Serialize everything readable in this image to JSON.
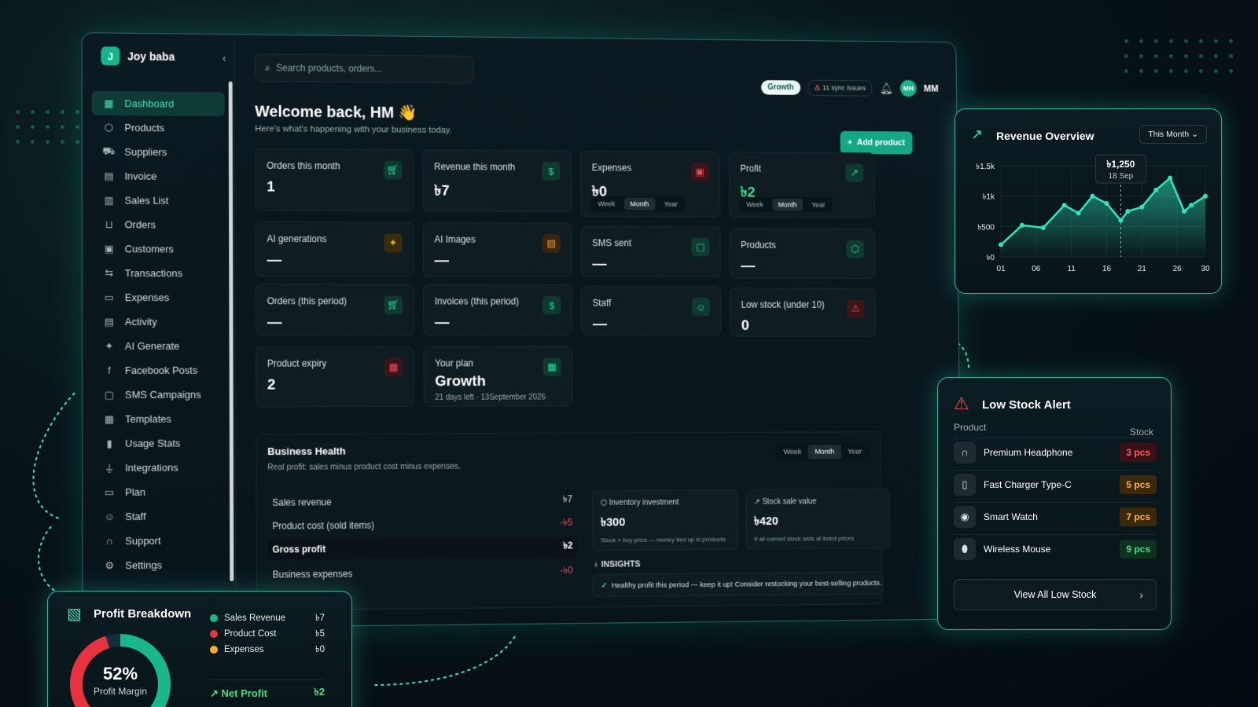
{
  "app": {
    "brand_initial": "J",
    "brand_name": "Joy baba"
  },
  "sidebar": {
    "items": [
      {
        "label": "Dashboard",
        "icon": "grid-icon",
        "glyph": "▦",
        "active": true
      },
      {
        "label": "Products",
        "icon": "cube-icon",
        "glyph": "⬡"
      },
      {
        "label": "Suppliers",
        "icon": "truck-icon",
        "glyph": "⛟"
      },
      {
        "label": "Invoice",
        "icon": "invoice-icon",
        "glyph": "▤"
      },
      {
        "label": "Sales List",
        "icon": "list-icon",
        "glyph": "▥"
      },
      {
        "label": "Orders",
        "icon": "cart-icon",
        "glyph": "⊔"
      },
      {
        "label": "Customers",
        "icon": "clipboard-icon",
        "glyph": "▣"
      },
      {
        "label": "Transactions",
        "icon": "arrows-icon",
        "glyph": "⇆"
      },
      {
        "label": "Expenses",
        "icon": "wallet-icon",
        "glyph": "▭"
      },
      {
        "label": "Activity",
        "icon": "activity-icon",
        "glyph": "▤"
      },
      {
        "label": "AI Generate",
        "icon": "sparkle-icon",
        "glyph": "✦"
      },
      {
        "label": "Facebook Posts",
        "icon": "facebook-icon",
        "glyph": "f"
      },
      {
        "label": "SMS Campaigns",
        "icon": "chat-icon",
        "glyph": "▢"
      },
      {
        "label": "Templates",
        "icon": "template-icon",
        "glyph": "▦"
      },
      {
        "label": "Usage Stats",
        "icon": "bar-chart-icon",
        "glyph": "▮"
      },
      {
        "label": "Integrations",
        "icon": "plug-icon",
        "glyph": "⏚"
      },
      {
        "label": "Plan",
        "icon": "card-icon",
        "glyph": "▭"
      },
      {
        "label": "Staff",
        "icon": "users-icon",
        "glyph": "☺"
      },
      {
        "label": "Support",
        "icon": "headset-icon",
        "glyph": "∩"
      },
      {
        "label": "Settings",
        "icon": "gear-icon",
        "glyph": "⚙"
      }
    ]
  },
  "header": {
    "search_placeholder": "Search products, orders...",
    "plan_badge": "Growth",
    "sync_issues": "11 sync issues",
    "avatar_initials": "MH",
    "user_name": "MM"
  },
  "welcome": {
    "title": "Welcome back, HM 👋",
    "subtitle": "Here's what's happening with your business today.",
    "add_product": "Add product"
  },
  "stats": {
    "orders_month": {
      "label": "Orders this month",
      "value": "1"
    },
    "revenue_month": {
      "label": "Revenue this month",
      "value": "৳7"
    },
    "expenses": {
      "label": "Expenses",
      "value": "৳0"
    },
    "profit": {
      "label": "Profit",
      "value": "৳2"
    },
    "ai_generations": {
      "label": "AI generations",
      "value": "—"
    },
    "ai_images": {
      "label": "AI Images",
      "value": "—"
    },
    "sms_sent": {
      "label": "SMS sent",
      "value": "—"
    },
    "products": {
      "label": "Products",
      "value": "—"
    },
    "orders_period": {
      "label": "Orders (this period)",
      "value": "—"
    },
    "invoices_period": {
      "label": "Invoices (this period)",
      "value": "—"
    },
    "staff": {
      "label": "Staff",
      "value": "—"
    },
    "low_stock": {
      "label": "Low stock (under 10)",
      "value": "0"
    },
    "product_expiry": {
      "label": "Product expiry",
      "value": "2"
    },
    "plan": {
      "label": "Your plan",
      "value": "Growth",
      "sub": "21 days left · 13September 2026"
    }
  },
  "period_tabs": [
    "Week",
    "Month",
    "Year"
  ],
  "business_health": {
    "title": "Business Health",
    "subtitle": "Real profit: sales minus product cost minus expenses.",
    "rows": [
      {
        "label": "Sales revenue",
        "value": "৳7"
      },
      {
        "label": "Product cost (sold items)",
        "value": "-৳5"
      },
      {
        "label": "Gross profit",
        "value": "৳2"
      },
      {
        "label": "Business expenses",
        "value": "-৳0"
      }
    ],
    "inventory": {
      "title": "Inventory investment",
      "value": "৳300",
      "desc": "Stock × buy price — money tied up in products"
    },
    "stock_value": {
      "title": "Stock sale value",
      "value": "৳420",
      "desc": "If all current stock sells at listed prices"
    },
    "insights_title": "INSIGHTS",
    "insight": "Healthy profit this period — keep it up! Consider restocking your best-selling products."
  },
  "revenue_overview": {
    "title": "Revenue Overview",
    "range": "This Month",
    "tooltip_value": "৳1,250",
    "tooltip_date": "18 Sep"
  },
  "chart_data": {
    "type": "area",
    "title": "Revenue Overview",
    "x_ticks": [
      "01",
      "06",
      "11",
      "16",
      "21",
      "26",
      "30"
    ],
    "y_ticks": [
      "৳0",
      "৳500",
      "৳1k",
      "৳1.5k"
    ],
    "ylim": [
      0,
      1500
    ],
    "x": [
      1,
      4,
      7,
      10,
      12,
      14,
      16,
      18,
      19,
      21,
      23,
      25,
      27,
      28,
      30
    ],
    "y": [
      200,
      520,
      480,
      850,
      720,
      1000,
      880,
      600,
      750,
      820,
      1100,
      1300,
      750,
      850,
      1000
    ],
    "accent": "#2ee6b8"
  },
  "low_stock_alert": {
    "title": "Low Stock Alert",
    "col_product": "Product",
    "col_stock": "Stock",
    "items": [
      {
        "name": "Premium Headphone",
        "qty": "3 pcs",
        "level": "red",
        "icon": "headphone-icon",
        "glyph": "∩"
      },
      {
        "name": "Fast Charger Type-C",
        "qty": "5 pcs",
        "level": "amb",
        "icon": "charger-icon",
        "glyph": "▯"
      },
      {
        "name": "Smart Watch",
        "qty": "7 pcs",
        "level": "amb",
        "icon": "watch-icon",
        "glyph": "◉"
      },
      {
        "name": "Wireless Mouse",
        "qty": "9 pcs",
        "level": "grn",
        "icon": "mouse-icon",
        "glyph": "⬮"
      }
    ],
    "view_all": "View All Low Stock"
  },
  "profit_breakdown": {
    "title": "Profit Breakdown",
    "margin": "52%",
    "margin_label": "Profit Margin",
    "legend": [
      {
        "label": "Sales Revenue",
        "value": "৳7",
        "color": "#18b88c"
      },
      {
        "label": "Product Cost",
        "value": "৳5",
        "color": "#e8333f"
      },
      {
        "label": "Expenses",
        "value": "৳0",
        "color": "#f1b01c"
      }
    ],
    "net_label": "Net Profit",
    "net_value": "৳2"
  }
}
